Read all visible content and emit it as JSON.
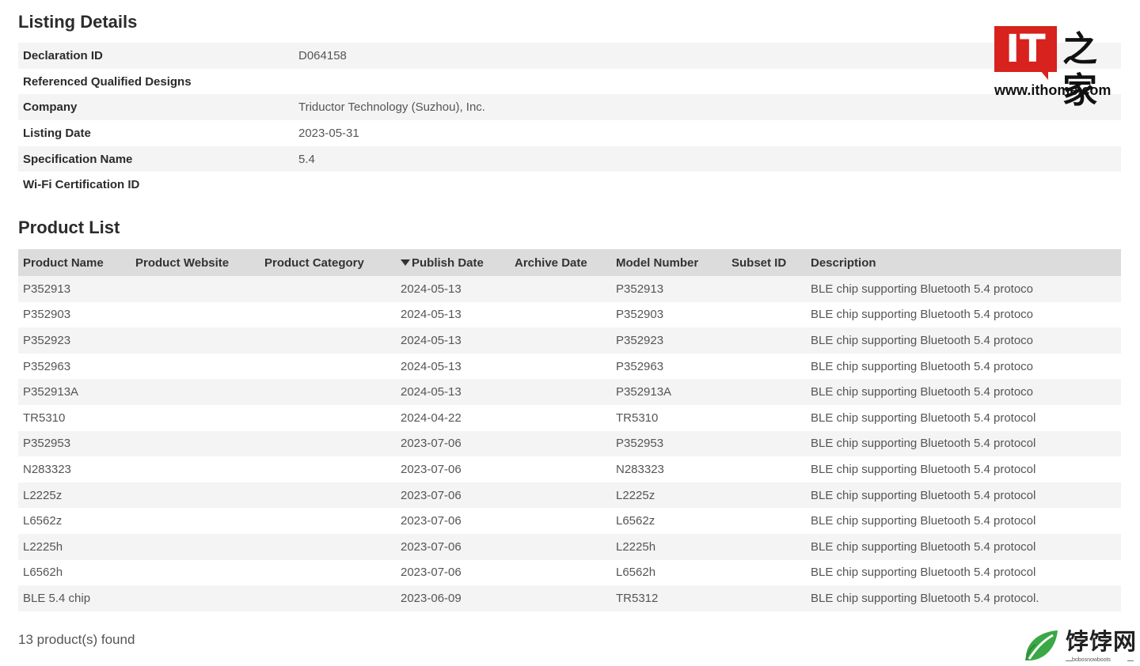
{
  "listing_details": {
    "title": "Listing Details",
    "rows": [
      {
        "label": "Declaration ID",
        "value": "D064158"
      },
      {
        "label": "Referenced Qualified Designs",
        "value": ""
      },
      {
        "label": "Company",
        "value": "Triductor Technology (Suzhou), Inc."
      },
      {
        "label": "Listing Date",
        "value": "2023-05-31"
      },
      {
        "label": "Specification Name",
        "value": "5.4"
      },
      {
        "label": "Wi-Fi Certification ID",
        "value": ""
      }
    ]
  },
  "product_list": {
    "title": "Product List",
    "columns": [
      "Product Name",
      "Product Website",
      "Product Category",
      "Publish Date",
      "Archive Date",
      "Model Number",
      "Subset ID",
      "Description"
    ],
    "sorted_column": "Publish Date",
    "sort_direction": "descending",
    "rows": [
      {
        "name": "P352913",
        "website": "",
        "category": "",
        "publish_date": "2024-05-13",
        "archive_date": "",
        "model": "P352913",
        "subset": "",
        "description": "BLE chip supporting Bluetooth 5.4 protoco"
      },
      {
        "name": "P352903",
        "website": "",
        "category": "",
        "publish_date": "2024-05-13",
        "archive_date": "",
        "model": "P352903",
        "subset": "",
        "description": "BLE chip supporting Bluetooth 5.4 protoco"
      },
      {
        "name": "P352923",
        "website": "",
        "category": "",
        "publish_date": "2024-05-13",
        "archive_date": "",
        "model": "P352923",
        "subset": "",
        "description": "BLE chip supporting Bluetooth 5.4 protoco"
      },
      {
        "name": "P352963",
        "website": "",
        "category": "",
        "publish_date": "2024-05-13",
        "archive_date": "",
        "model": "P352963",
        "subset": "",
        "description": "BLE chip supporting Bluetooth 5.4 protoco"
      },
      {
        "name": "P352913A",
        "website": "",
        "category": "",
        "publish_date": "2024-05-13",
        "archive_date": "",
        "model": "P352913A",
        "subset": "",
        "description": "BLE chip supporting Bluetooth 5.4 protoco"
      },
      {
        "name": "TR5310",
        "website": "",
        "category": "",
        "publish_date": "2024-04-22",
        "archive_date": "",
        "model": "TR5310",
        "subset": "",
        "description": "BLE chip supporting Bluetooth 5.4 protocol"
      },
      {
        "name": "P352953",
        "website": "",
        "category": "",
        "publish_date": "2023-07-06",
        "archive_date": "",
        "model": "P352953",
        "subset": "",
        "description": "BLE chip supporting Bluetooth 5.4 protocol"
      },
      {
        "name": "N283323",
        "website": "",
        "category": "",
        "publish_date": "2023-07-06",
        "archive_date": "",
        "model": "N283323",
        "subset": "",
        "description": "BLE chip supporting Bluetooth 5.4 protocol"
      },
      {
        "name": "L2225z",
        "website": "",
        "category": "",
        "publish_date": "2023-07-06",
        "archive_date": "",
        "model": "L2225z",
        "subset": "",
        "description": "BLE chip supporting Bluetooth 5.4 protocol"
      },
      {
        "name": "L6562z",
        "website": "",
        "category": "",
        "publish_date": "2023-07-06",
        "archive_date": "",
        "model": "L6562z",
        "subset": "",
        "description": "BLE chip supporting Bluetooth 5.4 protocol"
      },
      {
        "name": "L2225h",
        "website": "",
        "category": "",
        "publish_date": "2023-07-06",
        "archive_date": "",
        "model": "L2225h",
        "subset": "",
        "description": "BLE chip supporting Bluetooth 5.4 protocol"
      },
      {
        "name": "L6562h",
        "website": "",
        "category": "",
        "publish_date": "2023-07-06",
        "archive_date": "",
        "model": "L6562h",
        "subset": "",
        "description": "BLE chip supporting Bluetooth 5.4 protocol"
      },
      {
        "name": "BLE 5.4 chip",
        "website": "",
        "category": "",
        "publish_date": "2023-06-09",
        "archive_date": "",
        "model": "TR5312",
        "subset": "",
        "description": "BLE chip supporting Bluetooth 5.4 protocol."
      }
    ],
    "result_count": "13 product(s) found"
  },
  "watermarks": {
    "ithome_logo": "IT",
    "ithome_zh": "之家",
    "ithome_url": "www.ithome.com",
    "ithome_color": "#d7221d",
    "bobo_zh": "饽饽网",
    "bobo_en": "bobosnowboots",
    "bobo_color": "#3aa845"
  }
}
